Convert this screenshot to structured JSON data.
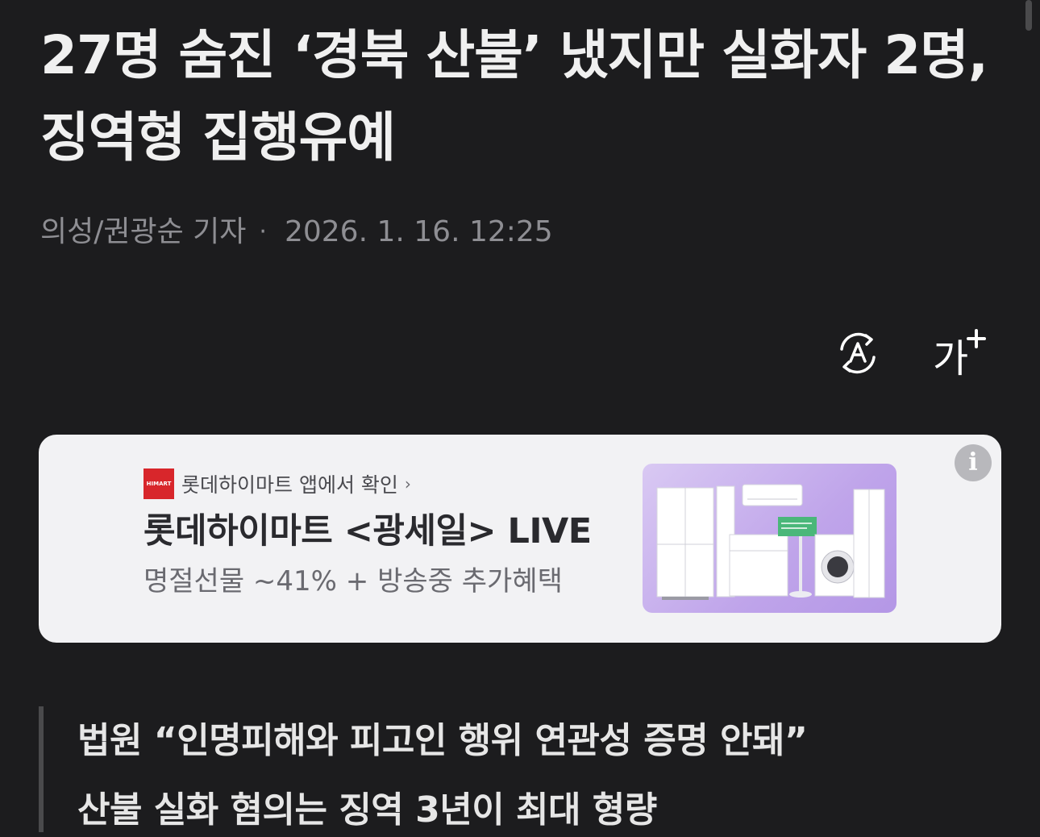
{
  "article": {
    "headline": "27명 숨진 ‘경북 산불’ 냈지만 실화자 2명, 징역형 집행유예",
    "reporter": "의성/권광순 기자",
    "separator": "·",
    "published": "2026. 1. 16. 12:25"
  },
  "toolbar": {
    "translate_icon": "auto-translate-icon",
    "font_size_icon": "font-size-icon",
    "font_size_label": "가"
  },
  "ad": {
    "logo_text": "HIMART",
    "brand_line": "롯데하이마트 앱에서 확인",
    "chevron": "›",
    "title": "롯데하이마트 <광세일> LIVE",
    "subtitle": "명절선물  ~41% + 방송중 추가혜택",
    "info_icon": "i",
    "accent_color": "#d8262b",
    "image_bg": "#c4aef0"
  },
  "subheadings": [
    "법원 “인명피해와 피고인 행위 연관성 증명 안돼”",
    "산불 실화 혐의는 징역 3년이 최대 형량"
  ]
}
